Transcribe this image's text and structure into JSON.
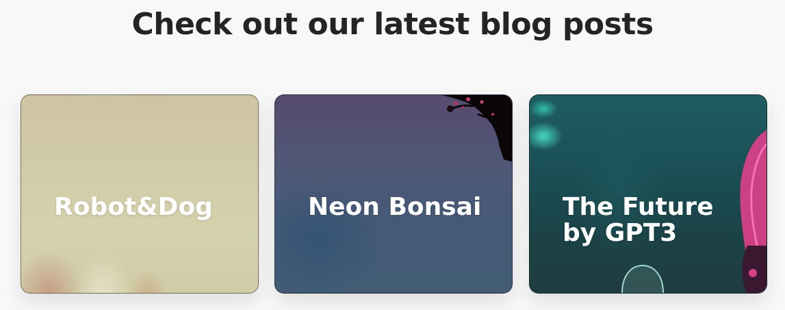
{
  "section": {
    "heading": "Check out our latest blog posts"
  },
  "posts": [
    {
      "title": "Robot&Dog"
    },
    {
      "title": "Neon Bonsai"
    },
    {
      "title": "The Future by GPT3"
    }
  ],
  "colors": {
    "heading_text": "#242424",
    "card_title_text": "#ffffff",
    "page_background": "#f8f8f8"
  }
}
